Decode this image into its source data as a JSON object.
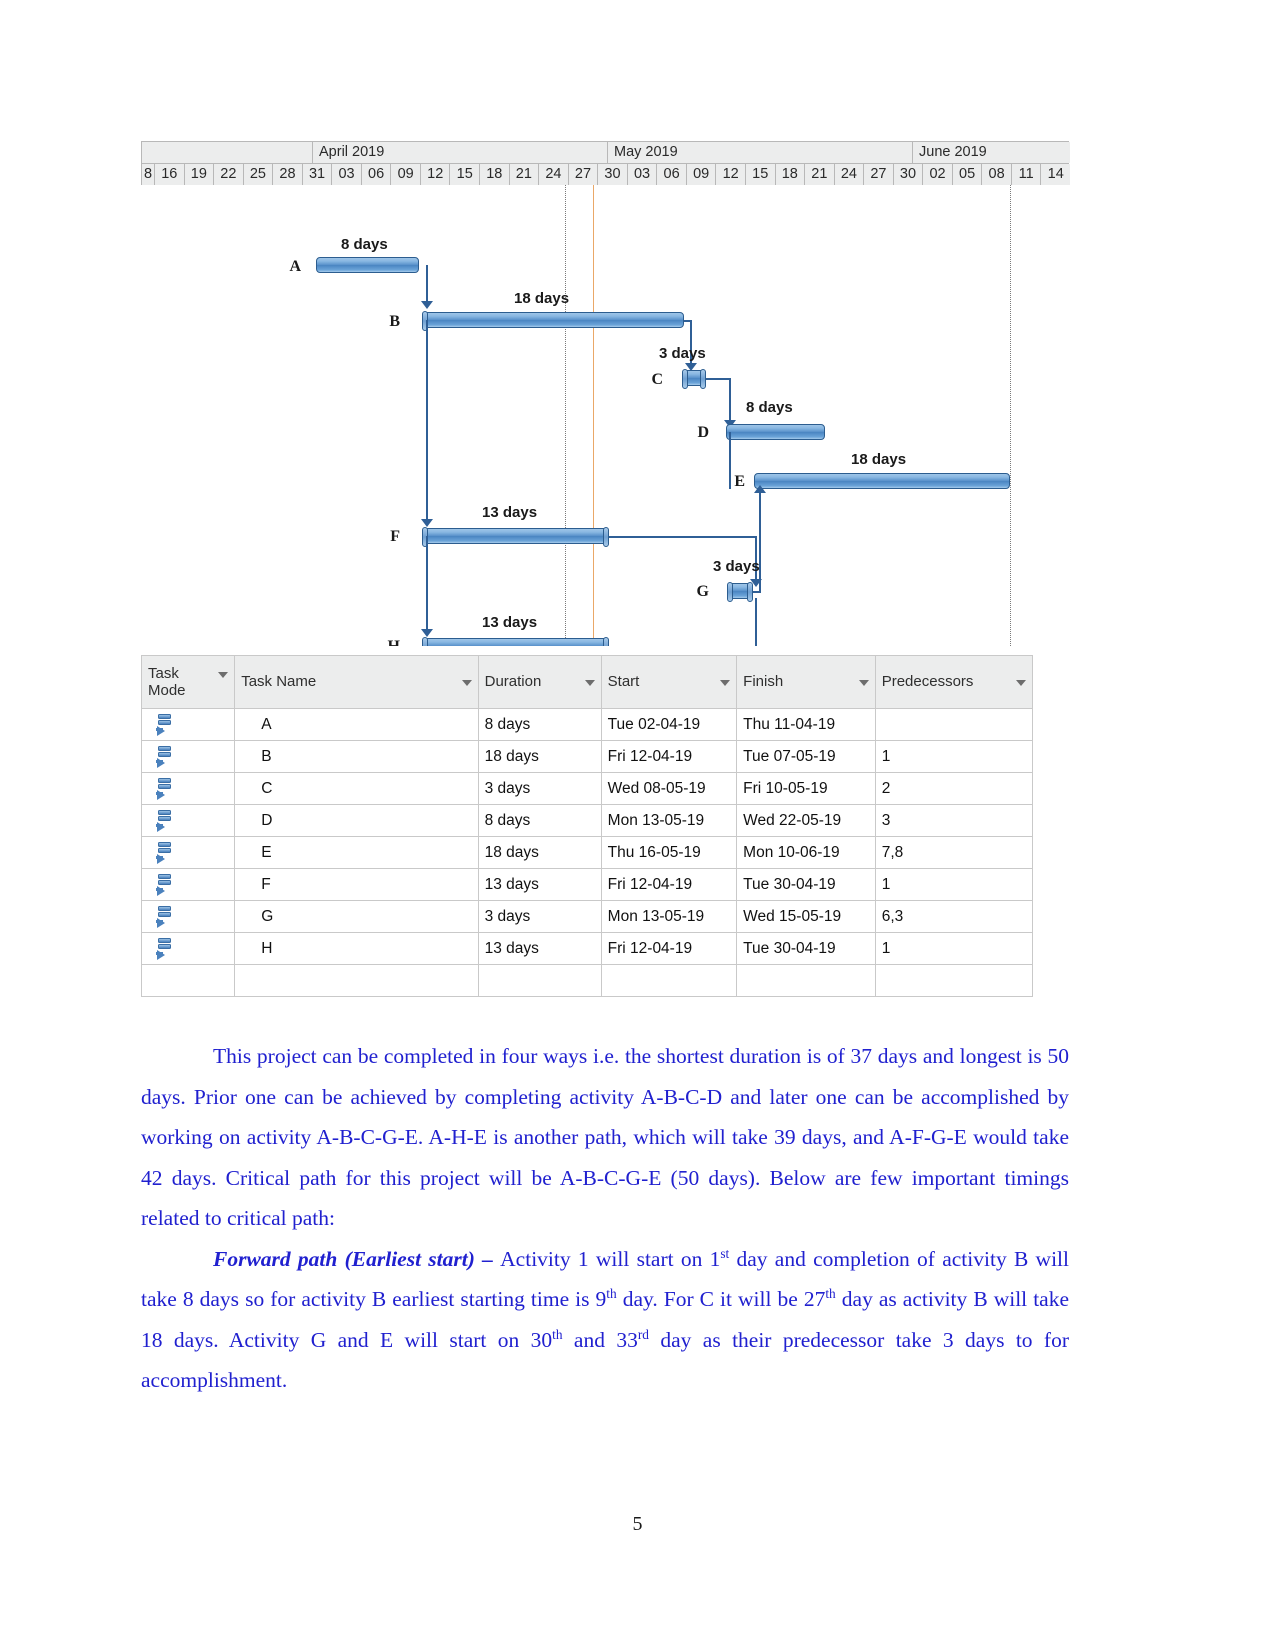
{
  "gantt": {
    "timeline": {
      "months": [
        {
          "label": "April 2019"
        },
        {
          "label": "May 2019"
        },
        {
          "label": "June 2019"
        }
      ],
      "day_ticks": [
        "8",
        "16",
        "19",
        "22",
        "25",
        "28",
        "31",
        "03",
        "06",
        "09",
        "12",
        "15",
        "18",
        "21",
        "24",
        "27",
        "30",
        "03",
        "06",
        "09",
        "12",
        "15",
        "18",
        "21",
        "24",
        "27",
        "30",
        "02",
        "05",
        "08",
        "11",
        "14"
      ]
    },
    "bars": [
      {
        "task": "A",
        "duration_label": "8 days"
      },
      {
        "task": "B",
        "duration_label": "18 days"
      },
      {
        "task": "C",
        "duration_label": "3 days"
      },
      {
        "task": "D",
        "duration_label": "8 days"
      },
      {
        "task": "E",
        "duration_label": "18 days"
      },
      {
        "task": "F",
        "duration_label": "13 days"
      },
      {
        "task": "G",
        "duration_label": "3 days"
      },
      {
        "task": "H",
        "duration_label": "13 days"
      }
    ],
    "colors": {
      "bar_fill": "#4a85c2",
      "bar_border": "#2c5d8f",
      "link_line": "#2f5f96",
      "today_line": "#eaa868",
      "header_bg": "#eceded"
    }
  },
  "table": {
    "headers": [
      {
        "label": "Task Mode"
      },
      {
        "label": "Task Name"
      },
      {
        "label": "Duration"
      },
      {
        "label": "Start"
      },
      {
        "label": "Finish"
      },
      {
        "label": "Predecessors"
      }
    ],
    "rows": [
      {
        "mode": "auto-scheduled",
        "name": "A",
        "duration": "8 days",
        "start": "Tue 02-04-19",
        "finish": "Thu 11-04-19",
        "predecessors": ""
      },
      {
        "mode": "auto-scheduled",
        "name": "B",
        "duration": "18 days",
        "start": "Fri 12-04-19",
        "finish": "Tue 07-05-19",
        "predecessors": "1"
      },
      {
        "mode": "auto-scheduled",
        "name": "C",
        "duration": "3 days",
        "start": "Wed 08-05-19",
        "finish": "Fri 10-05-19",
        "predecessors": "2"
      },
      {
        "mode": "auto-scheduled",
        "name": "D",
        "duration": "8 days",
        "start": "Mon 13-05-19",
        "finish": "Wed 22-05-19",
        "predecessors": "3"
      },
      {
        "mode": "auto-scheduled",
        "name": "E",
        "duration": "18 days",
        "start": "Thu 16-05-19",
        "finish": "Mon 10-06-19",
        "predecessors": "7,8"
      },
      {
        "mode": "auto-scheduled",
        "name": "F",
        "duration": "13 days",
        "start": "Fri 12-04-19",
        "finish": "Tue 30-04-19",
        "predecessors": "1"
      },
      {
        "mode": "auto-scheduled",
        "name": "G",
        "duration": "3 days",
        "start": "Mon 13-05-19",
        "finish": "Wed 15-05-19",
        "predecessors": "6,3"
      },
      {
        "mode": "auto-scheduled",
        "name": "H",
        "duration": "13 days",
        "start": "Fri 12-04-19",
        "finish": "Tue 30-04-19",
        "predecessors": "1"
      },
      {
        "mode": "",
        "name": "",
        "duration": "",
        "start": "",
        "finish": "",
        "predecessors": ""
      }
    ]
  },
  "document": {
    "paragraph1": "This project can be completed in four ways i.e. the shortest duration is of 37 days and longest is 50 days. Prior one can be achieved by completing activity A-B-C-D and later one can be accomplished by working on activity A-B-C-G-E. A-H-E is another path, which will take 39 days, and A-F-G-E would take 42 days. Critical path for this project will be A-B-C-G-E (50 days). Below are few important timings related to critical path:",
    "paragraph2": {
      "lead": "Forward path (Earliest start) – ",
      "seg1": "Activity 1 will start on 1",
      "sup1": "st",
      "seg2": " day and completion of activity B will take 8 days so for activity B earliest starting time is 9",
      "sup2": "th",
      "seg3": " day. For C it will be 27",
      "sup3": "th",
      "seg4": " day as activity B will take 18 days. Activity G and E will start on 30",
      "sup4": "th",
      "seg5": " and 33",
      "sup5": "rd",
      "seg6": " day as their predecessor take 3 days to for accomplishment."
    },
    "page_number": "5",
    "text_color": "#2020cf"
  }
}
